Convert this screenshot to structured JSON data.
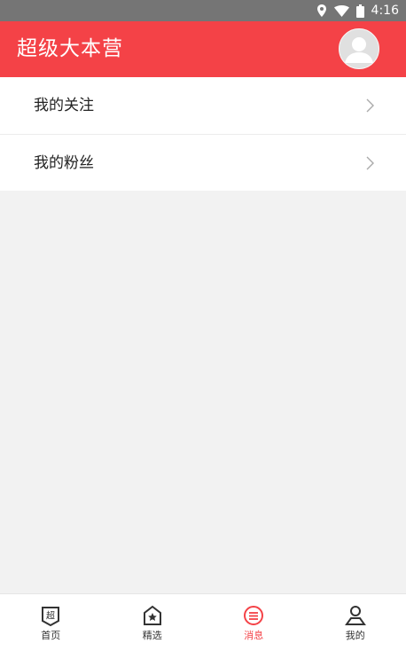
{
  "status_bar": {
    "time": "4:16"
  },
  "app_bar": {
    "title": "超级大本营"
  },
  "list": {
    "items": [
      {
        "label": "我的关注"
      },
      {
        "label": "我的粉丝"
      }
    ]
  },
  "bottom_nav": {
    "items": [
      {
        "label": "首页",
        "icon": "home-shield-icon"
      },
      {
        "label": "精选",
        "icon": "star-tag-icon"
      },
      {
        "label": "消息",
        "icon": "message-icon",
        "active": true
      },
      {
        "label": "我的",
        "icon": "profile-icon"
      }
    ]
  },
  "colors": {
    "primary": "#f44247",
    "status_bar": "#757575",
    "background": "#f2f2f2"
  }
}
